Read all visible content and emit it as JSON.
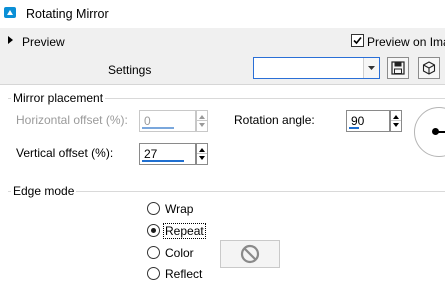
{
  "window": {
    "title": "Rotating Mirror",
    "accent": "#0a8fd6"
  },
  "preview_bar": {
    "expand_label": "Preview",
    "preview_on_label": "Preview on Ima",
    "preview_on_checked": true
  },
  "settings_bar": {
    "label": "Settings",
    "preset_value": "",
    "icons": [
      "save-preset-icon",
      "reset-preset-icon"
    ]
  },
  "mirror_placement": {
    "title": "Mirror placement",
    "horizontal_offset": {
      "label": "Horizontal offset (%):",
      "value": "0",
      "enabled": false
    },
    "vertical_offset": {
      "label": "Vertical offset (%):",
      "value": "27",
      "enabled": true
    },
    "rotation_angle": {
      "label": "Rotation angle:",
      "value": "90"
    }
  },
  "edge_mode": {
    "title": "Edge mode",
    "options": [
      {
        "label": "Wrap",
        "selected": false
      },
      {
        "label": "Repeat",
        "selected": true
      },
      {
        "label": "Color",
        "selected": false
      },
      {
        "label": "Reflect",
        "selected": false
      }
    ],
    "color_swatch_icon": "no-color-icon"
  }
}
